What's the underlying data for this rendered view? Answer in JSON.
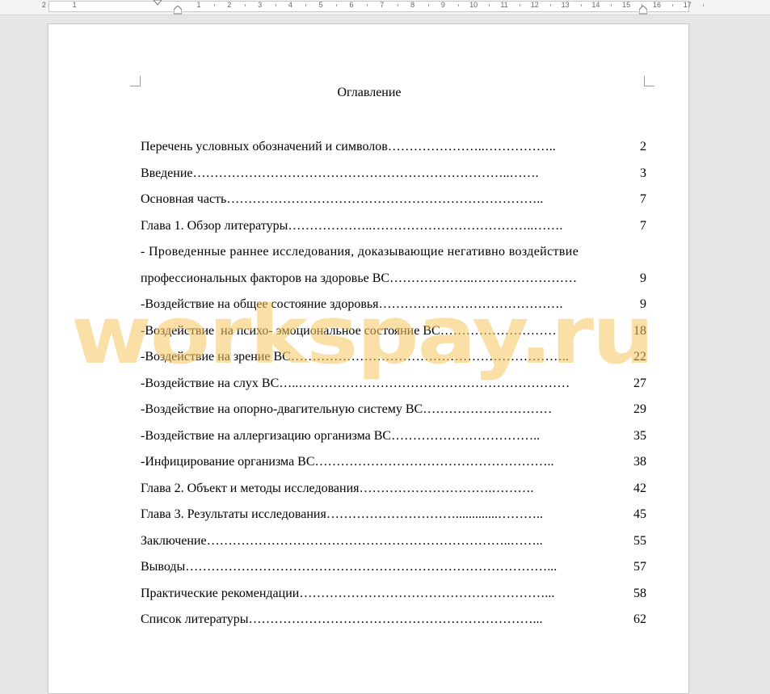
{
  "ruler": {
    "left_numbers": [
      "2",
      "1"
    ],
    "right_numbers": [
      "1",
      "2",
      "3",
      "4",
      "5",
      "6",
      "7",
      "8",
      "9",
      "10",
      "11",
      "12",
      "13",
      "14",
      "15",
      "16",
      "17"
    ]
  },
  "document": {
    "title": "Оглавление",
    "toc": [
      {
        "text": "Перечень условных обозначений и символов…………………..……………..",
        "page": "2"
      },
      {
        "text": "Введение………………………………………………………………..…….",
        "page": "3"
      },
      {
        "text": "Основная часть……………………………………………………………….. ",
        "page": "7"
      },
      {
        "text": "Глава 1. Обзор литературы………………..………………………………..…….",
        "page": "7"
      },
      {
        "text": "- Проведенные раннее исследования, доказывающие негативно воздействие",
        "page": ""
      },
      {
        "text": "профессиональных факторов на здоровье ВС………………..……………………",
        "page": "9"
      },
      {
        "text": "-Воздействие на общее состояние здоровья…………………………………….",
        "page": "9"
      },
      {
        "text": "-Воздействие  на психо- эмоциональное состояние ВС………………………",
        "page": "18"
      },
      {
        "text": "-Воздействие на зрение ВС………………………………………………………..",
        "page": "22"
      },
      {
        "text": "-Воздействие на слух ВС…..………………………………………………………",
        "page": "27"
      },
      {
        "text": "-Воздействие на опорно-двагительную систему ВС…………………………",
        "page": "29"
      },
      {
        "text": "-Воздействие на аллергизацию организма ВС……………………………..",
        "page": "35"
      },
      {
        "text": "-Инфицирование организма ВС………………………………………………..",
        "page": "38"
      },
      {
        "text": "Глава 2. Объект и методы исследования………………………….……….",
        "page": "42"
      },
      {
        "text": "Глава 3. Результаты исследования………………………….............………..",
        "page": "45"
      },
      {
        "text": "Заключение……………………………………………………………..……..",
        "page": "55"
      },
      {
        "text": "Выводы…………………………………………………………………………...",
        "page": "57"
      },
      {
        "text": "Практические рекомендации…………………………………………………...",
        "page": "58"
      },
      {
        "text": "Список литературы…………………………………………………………...",
        "page": "62"
      }
    ]
  },
  "watermark": {
    "text": "workspay.ru",
    "color": "#f5c45c"
  }
}
